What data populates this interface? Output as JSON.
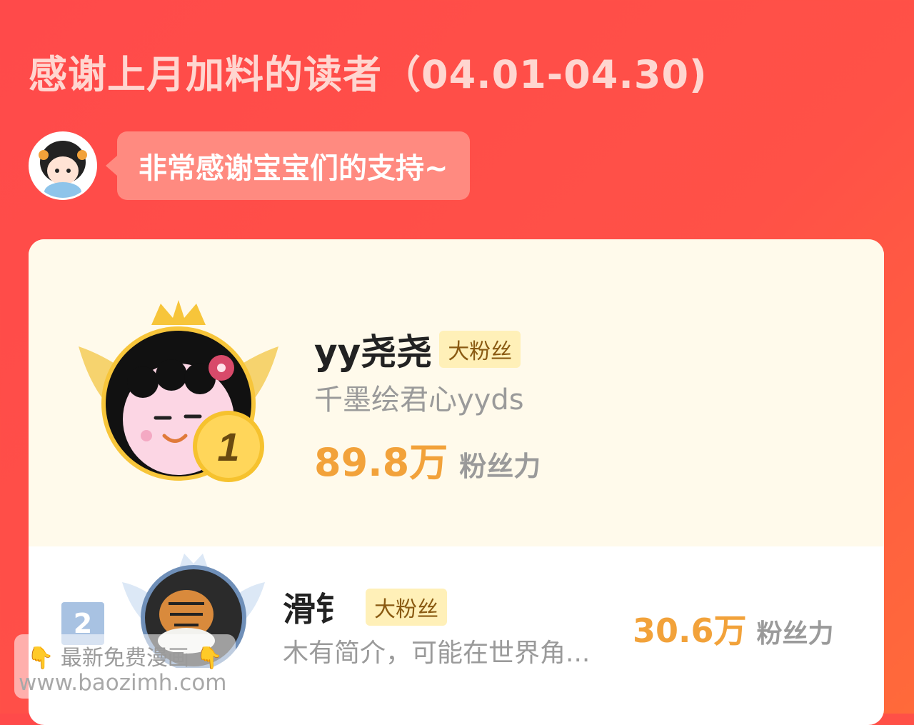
{
  "header": {
    "title": "感谢上月加料的读者（04.01-04.30)",
    "message": "非常感谢宝宝们的支持~"
  },
  "ranking": [
    {
      "rank": "1",
      "name": "yy尧尧",
      "badge": "大粉丝",
      "bio": "千墨绘君心yyds",
      "power": "89.8万",
      "power_unit": "粉丝力"
    },
    {
      "rank": "2",
      "name": "滑钅",
      "badge": "大粉丝",
      "bio": "木有简介，可能在世界角...",
      "power": "30.6万",
      "power_unit": "粉丝力"
    }
  ],
  "watermark": {
    "line1": "最新免费漫画",
    "line2": "www.baozimh.com"
  },
  "colors": {
    "background": "#ff4a4a",
    "accent_number": "#f2a23a",
    "badge_bg": "#fff0b8",
    "rank2_box": "#a8c2e2"
  },
  "icons": [
    "author-avatar",
    "crown-icon",
    "wings-icon",
    "rank-1-medal-icon",
    "pointing-down-icon"
  ]
}
